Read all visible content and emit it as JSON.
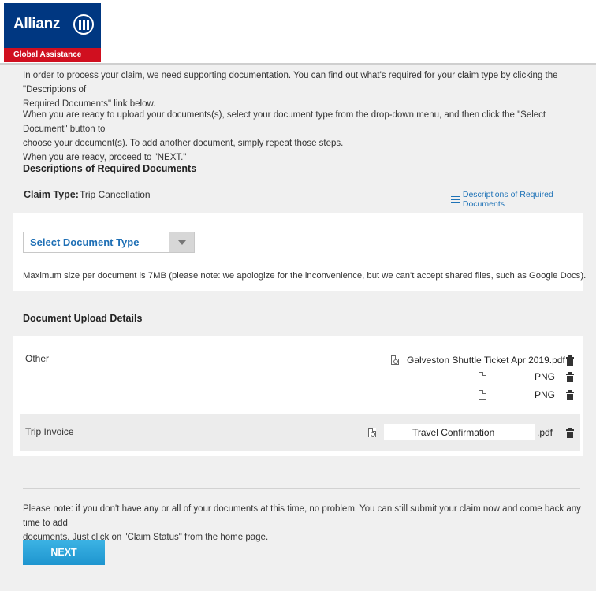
{
  "brand": {
    "name": "Allianz",
    "tagline": "Global Assistance",
    "colors": {
      "blue": "#003781",
      "red": "#d00f1f",
      "link": "#1f73b7",
      "button": "#2ea3db"
    }
  },
  "intro": {
    "para1_line1": "In order to process your claim, we need supporting documentation. You can find out what's required for your claim type by clicking the \"Descriptions of",
    "para1_line2": "Required Documents\" link below.",
    "para2_line1": "When you are ready to upload your documents(s), select your document type from the drop-down menu, and then click the \"Select Document\" button to",
    "para2_line2": "choose your document(s). To add another document, simply repeat those steps.",
    "para2_line3": "When you are ready, proceed to \"NEXT.\""
  },
  "descriptions_heading": "Descriptions of Required Documents",
  "claim": {
    "label": "Claim Type:",
    "value": "Trip Cancellation",
    "link_label": "Descriptions of Required Documents",
    "link_icon": "list-icon"
  },
  "document_select": {
    "selected": "Select Document Type",
    "max_size_note": "Maximum size per document is 7MB (please note:  we apologize for the inconvenience, but we can't accept shared files, such as Google Docs)."
  },
  "upload_details": {
    "heading": "Document Upload Details",
    "groups": [
      {
        "label": "Other",
        "files": [
          {
            "name": "Galveston Shuttle Ticket Apr 2019.pdf",
            "icon": "pdf-icon"
          },
          {
            "name": "PNG",
            "icon": "file-icon"
          },
          {
            "name": "PNG",
            "icon": "file-icon"
          }
        ]
      },
      {
        "label": "Trip Invoice",
        "files": [
          {
            "name": "Travel Confirmation",
            "suffix": ".pdf",
            "icon": "pdf-icon"
          }
        ]
      }
    ]
  },
  "footer": {
    "note_line1": "Please note: if you don't have any or all of your documents at this time, no problem. You can still submit your claim now and come back any time to add",
    "note_line2": "documents. Just click on \"Claim Status\" from the home page.",
    "next_label": "NEXT"
  }
}
